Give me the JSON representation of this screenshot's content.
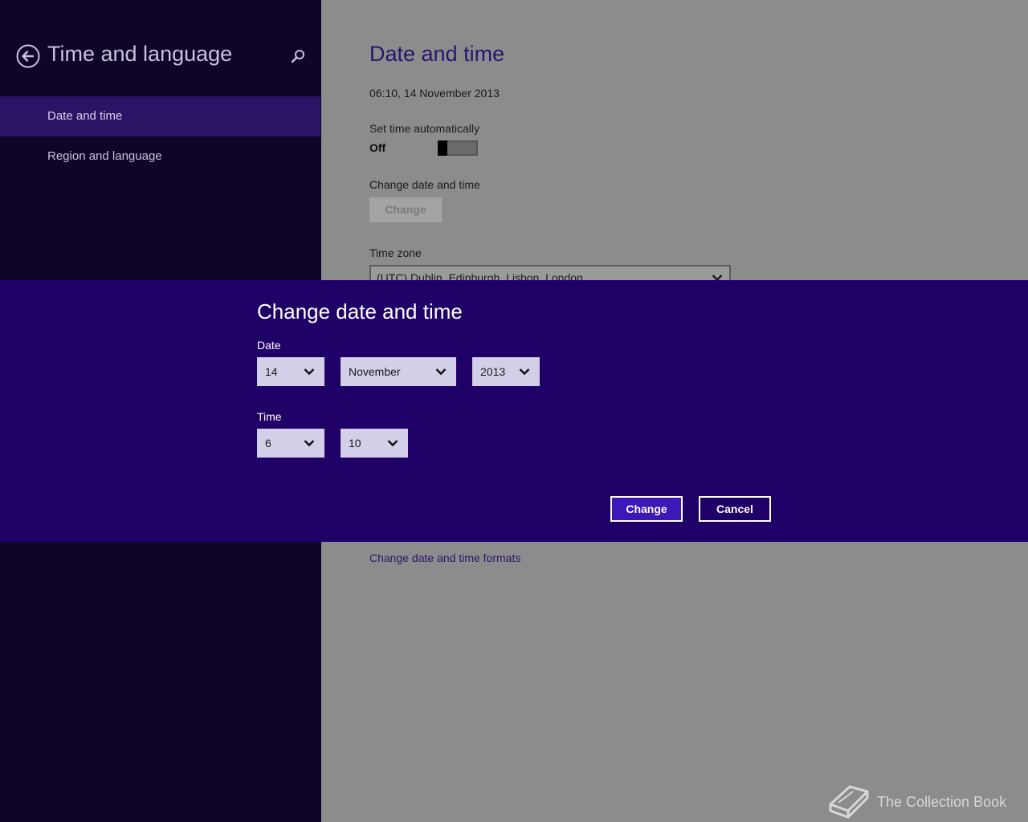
{
  "sidebar": {
    "title": "Time and language",
    "items": [
      {
        "label": "Date and time",
        "selected": true
      },
      {
        "label": "Region and language",
        "selected": false
      }
    ]
  },
  "main": {
    "title": "Date and time",
    "current_datetime": "06:10, 14 November 2013",
    "set_time_auto_label": "Set time automatically",
    "set_time_auto_state": "Off",
    "change_section_label": "Change date and time",
    "change_button_label": "Change",
    "timezone_label": "Time zone",
    "timezone_value": "(UTC) Dublin, Edinburgh, Lisbon, London",
    "formats_link": "Change date and time formats"
  },
  "dialog": {
    "title": "Change date and time",
    "date_label": "Date",
    "day": "14",
    "month": "November",
    "year": "2013",
    "time_label": "Time",
    "hour": "6",
    "minute": "10",
    "change_label": "Change",
    "cancel_label": "Cancel"
  },
  "watermark": {
    "text": "The Collection Book"
  },
  "colors": {
    "sidebar_bg": "#0e0528",
    "sidebar_selected": "#2a1465",
    "dialog_bg": "#1f0066",
    "accent_button": "#3c18b8",
    "dimmed_main_bg": "#8c8c8c"
  }
}
